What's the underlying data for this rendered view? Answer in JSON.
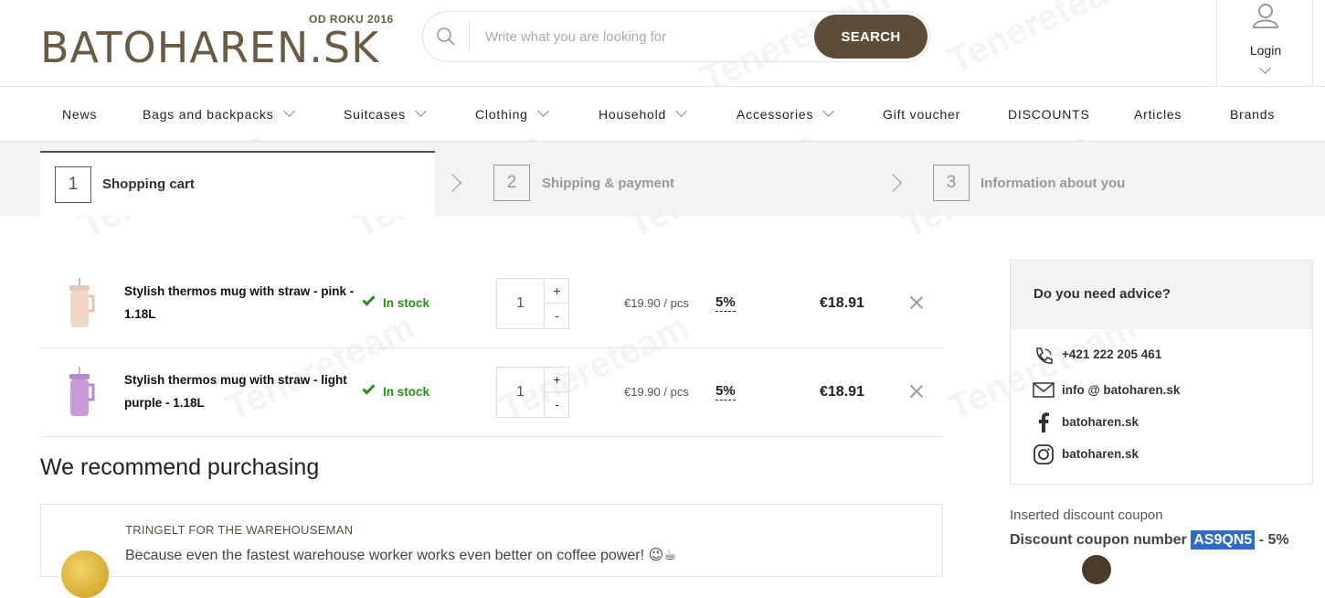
{
  "header": {
    "logo_text": "BATOHAREN.SK",
    "logo_tagline": "OD ROKU 2016",
    "search_placeholder": "Write what you are looking for",
    "search_button": "SEARCH",
    "login_label": "Login"
  },
  "nav": {
    "items": [
      {
        "label": "News"
      },
      {
        "label": "Bags and backpacks"
      },
      {
        "label": "Suitcases"
      },
      {
        "label": "Clothing"
      },
      {
        "label": "Household"
      },
      {
        "label": "Accessories"
      },
      {
        "label": "Gift voucher"
      },
      {
        "label": "DISCOUNTS"
      },
      {
        "label": "Articles"
      },
      {
        "label": "Brands"
      }
    ]
  },
  "steps": [
    {
      "number": "1",
      "label": "Shopping cart"
    },
    {
      "number": "2",
      "label": "Shipping & payment"
    },
    {
      "number": "3",
      "label": "Information about you"
    }
  ],
  "cart": {
    "items": [
      {
        "name": "Stylish thermos mug with straw - pink - 1.18L",
        "stock": "In stock",
        "quantity": "1",
        "unit_price": "€19.90 / pcs",
        "discount": "5%",
        "total": "€18.91",
        "color": "#f0d6c6"
      },
      {
        "name": "Stylish thermos mug with straw - light purple - 1.18L",
        "stock": "In stock",
        "quantity": "1",
        "unit_price": "€19.90 / pcs",
        "discount": "5%",
        "total": "€18.91",
        "color": "#c99ad8"
      }
    ],
    "plus_label": "+",
    "minus_label": "-"
  },
  "recommend": {
    "title": "We recommend purchasing",
    "item_name": "TRINGELT FOR THE WAREHOUSEMAN",
    "item_desc": "Because even the fastest warehouse worker works even better on coffee power! 😉☕"
  },
  "advice": {
    "title": "Do you need advice?",
    "phone": "+421 222 205 461",
    "email": "info @ batoharen.sk",
    "facebook": "batoharen.sk",
    "instagram": "batoharen.sk"
  },
  "coupon": {
    "label": "Inserted discount coupon",
    "prefix": "Discount coupon number",
    "code": "AS9QN5",
    "suffix": " - 5%"
  },
  "colors": {
    "brand": "#5e4c38",
    "in_stock": "#2e8b21",
    "highlight": "#2f6ac9"
  }
}
